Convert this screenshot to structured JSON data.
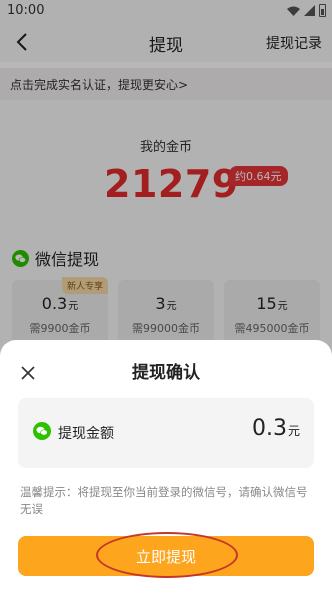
{
  "status": {
    "time": "10:00"
  },
  "nav": {
    "title": "提现",
    "right_link": "提现记录"
  },
  "verify_banner": {
    "text": "点击完成实名认证，提现更安心>"
  },
  "coins": {
    "label": "我的金币",
    "value": "21279",
    "approx": "约0.64元"
  },
  "wechat": {
    "title": "微信提现",
    "options": [
      {
        "badge": "新人专享",
        "amount": "0.3",
        "unit": "元",
        "cost": "需9900金币"
      },
      {
        "badge": "",
        "amount": "3",
        "unit": "元",
        "cost": "需99000金币"
      },
      {
        "badge": "",
        "amount": "15",
        "unit": "元",
        "cost": "需495000金币"
      }
    ]
  },
  "dialog": {
    "title": "提现确认",
    "amount_label": "提现金额",
    "amount_value": "0.3",
    "amount_unit": "元",
    "notice": "温馨提示：将提现至你当前登录的微信号，请确认微信号无误",
    "confirm_label": "立即提现"
  },
  "colors": {
    "accent": "#fda51c",
    "coin_red": "#e22a2a",
    "wechat_green": "#2dc100",
    "annotation_red": "#c4362a"
  },
  "icons": [
    "back-icon",
    "wifi-icon",
    "signal-icon",
    "battery-icon",
    "wechat-icon",
    "close-icon"
  ]
}
